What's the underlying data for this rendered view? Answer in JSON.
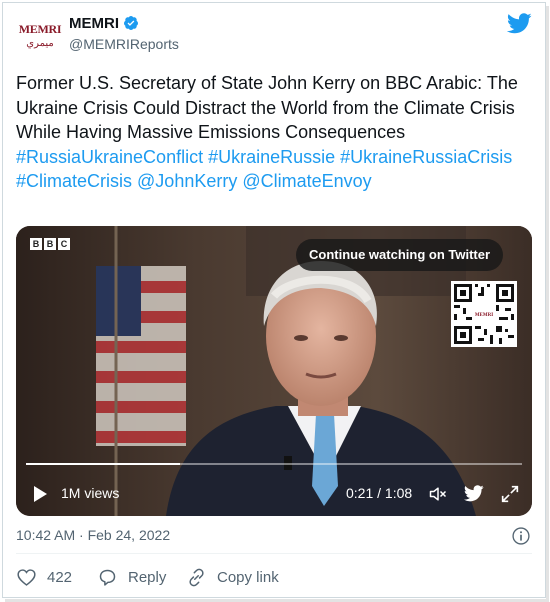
{
  "author": {
    "name": "MEMRI",
    "handle": "@MEMRIReports",
    "avatar_text": "MEMRI",
    "avatar_text_ar": "ميمري",
    "verified": true
  },
  "tweet": {
    "text": "Former U.S. Secretary of State John Kerry on BBC Arabic: The Ukraine Crisis Could Distract the World from the Climate Crisis While Having Massive Emissions Consequences",
    "hashtags": [
      "#RussiaUkraineConflict",
      "#UkraineRussie",
      "#UkraineRussiaCrisis",
      "#ClimateCrisis"
    ],
    "mentions": [
      "@JohnKerry",
      "@ClimateEnvoy"
    ],
    "timestamp": "10:42 AM · Feb 24, 2022"
  },
  "video": {
    "logo_letters": [
      "B",
      "B",
      "C"
    ],
    "continue_label": "Continue watching on Twitter",
    "views": "1M views",
    "time": "0:21 / 1:08",
    "progress": 0.31
  },
  "actions": {
    "likes": "422",
    "reply_label": "Reply",
    "copy_link_label": "Copy link"
  },
  "colors": {
    "link": "#1d9bf0",
    "verified": "#1d9bf0",
    "muted": "#536471"
  },
  "icons": [
    "verified-badge-icon",
    "twitter-bird-icon",
    "play-icon",
    "volume-icon",
    "expand-icon",
    "info-icon",
    "heart-icon",
    "reply-icon",
    "link-icon"
  ]
}
